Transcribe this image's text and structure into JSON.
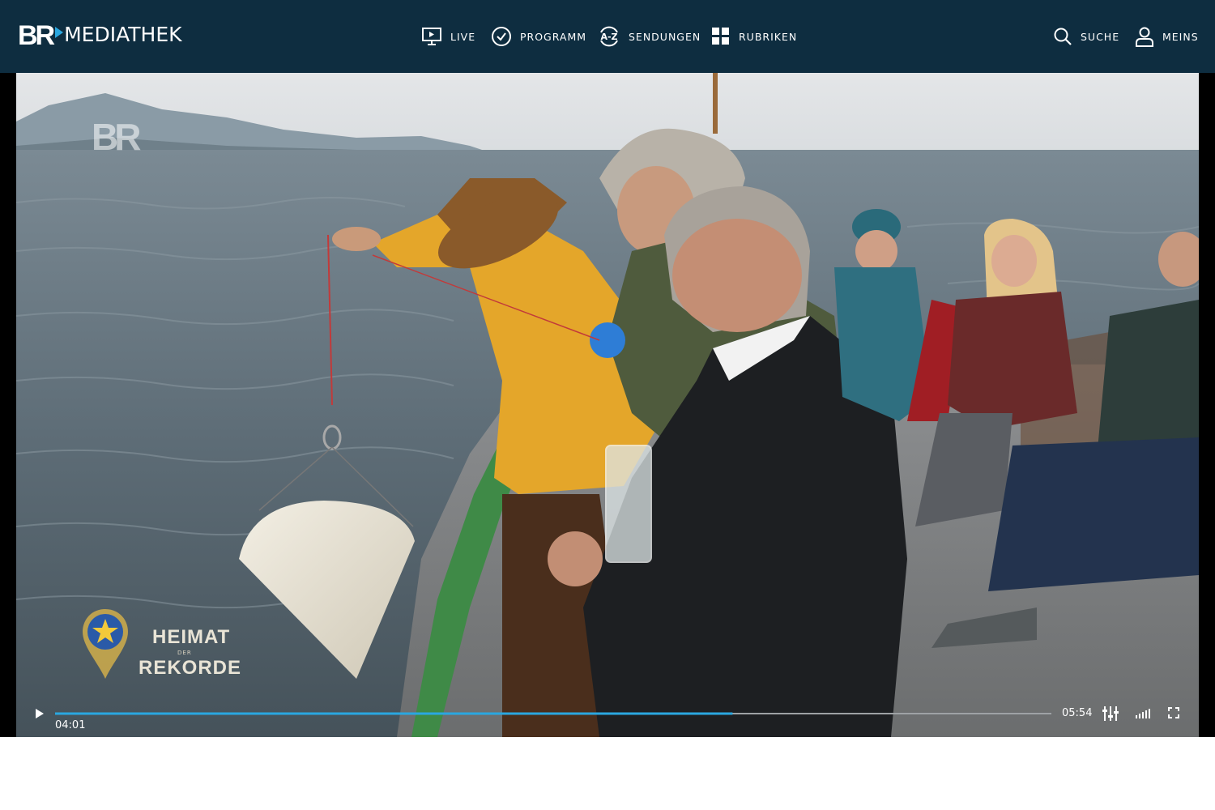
{
  "header": {
    "logo_br": "BR",
    "logo_text": "MEDIATHEK",
    "nav": [
      {
        "label": "LIVE",
        "icon": "monitor-play-icon"
      },
      {
        "label": "PROGRAMM",
        "icon": "clock-icon"
      },
      {
        "label": "SENDUNGEN",
        "icon": "a-z-icon"
      },
      {
        "label": "RUBRIKEN",
        "icon": "grid-icon"
      }
    ],
    "right": [
      {
        "label": "SUCHE",
        "icon": "search-icon"
      },
      {
        "label": "MEINS",
        "icon": "user-icon"
      }
    ],
    "az_glyph": "A-Z"
  },
  "video": {
    "watermark": "BR",
    "show_logo": {
      "top": "HEIMAT",
      "middle": "DER",
      "bottom": "REKORDE"
    },
    "current_time": "04:01",
    "duration": "05:54",
    "progress_fraction": 0.68,
    "icons": [
      "play-icon",
      "settings-sliders-icon",
      "volume-icon",
      "fullscreen-icon"
    ]
  },
  "colors": {
    "header_bg": "#0e2d40",
    "accent": "#2aa7e0",
    "video_bg": "#000000"
  }
}
